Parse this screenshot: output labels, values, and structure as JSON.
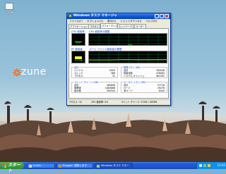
{
  "desktop": {
    "icon_label": "ごみ箱",
    "wallpaper_logo": "zune"
  },
  "taskman": {
    "title": "Windows タスク マネージャ",
    "menu": [
      "ファイル(F)",
      "オプション(O)",
      "表示(V)",
      "シャットダウン(U)",
      "ヘルプ(H)"
    ],
    "tabs": [
      "アプリケーション",
      "プロセス",
      "パフォーマンス",
      "ネットワーク",
      "ユーザー"
    ],
    "active_tab": "パフォーマンス",
    "cpu_usage_label": "CPU 使用率",
    "cpu_history_label": "CPU 使用率の履歴",
    "pf_usage_label": "PF 使用量",
    "pf_history_label": "ページ ファイル使用量の履歴",
    "cpu_value": "0 %",
    "cpu_fraction": 0.03,
    "pf_value": "274 MB",
    "pf_fraction": 0.35,
    "totals": {
      "caption": "合計",
      "rows": [
        {
          "k": "ハンドル",
          "v": "5550"
        },
        {
          "k": "スレッド",
          "v": "386"
        },
        {
          "k": "プロセス",
          "v": "32"
        }
      ]
    },
    "physical": {
      "caption": "物理メモリ (KB)",
      "rows": [
        {
          "k": "合計",
          "v": "782048"
        },
        {
          "k": "利用可能",
          "v": "476064"
        },
        {
          "k": "システム キャッシュ",
          "v": "461592"
        }
      ]
    },
    "commit": {
      "caption": "コミット チャージ (KB)",
      "rows": [
        {
          "k": "合計",
          "v": "280808"
        },
        {
          "k": "制限値",
          "v": "1883688"
        },
        {
          "k": "最大値",
          "v": "300344"
        }
      ]
    },
    "kernel": {
      "caption": "カーネル メモリ (KB)",
      "rows": [
        {
          "k": "合計",
          "v": "37716"
        },
        {
          "k": "ページ",
          "v": "29276"
        },
        {
          "k": "非ページ",
          "v": "8440"
        }
      ]
    },
    "status": {
      "processes": "プロセス: 32",
      "cpu": "CPU 使用率: 0%",
      "commit": "コミット チャージ: 274M / 1839M"
    }
  },
  "taskbar": {
    "start_label": "スタート",
    "buttons": [
      {
        "label": "tucker",
        "active": false
      },
      {
        "label": "Blogger: 更新します",
        "active": false
      },
      {
        "label": "Windows タスク マネー",
        "active": true
      }
    ],
    "clock": "13:45"
  },
  "colors": {
    "meter_green": "#30ff30",
    "titlebar_blue": "#0a53d8",
    "start_green": "#3a9a3c",
    "zune_orange": "#f26a1b"
  }
}
